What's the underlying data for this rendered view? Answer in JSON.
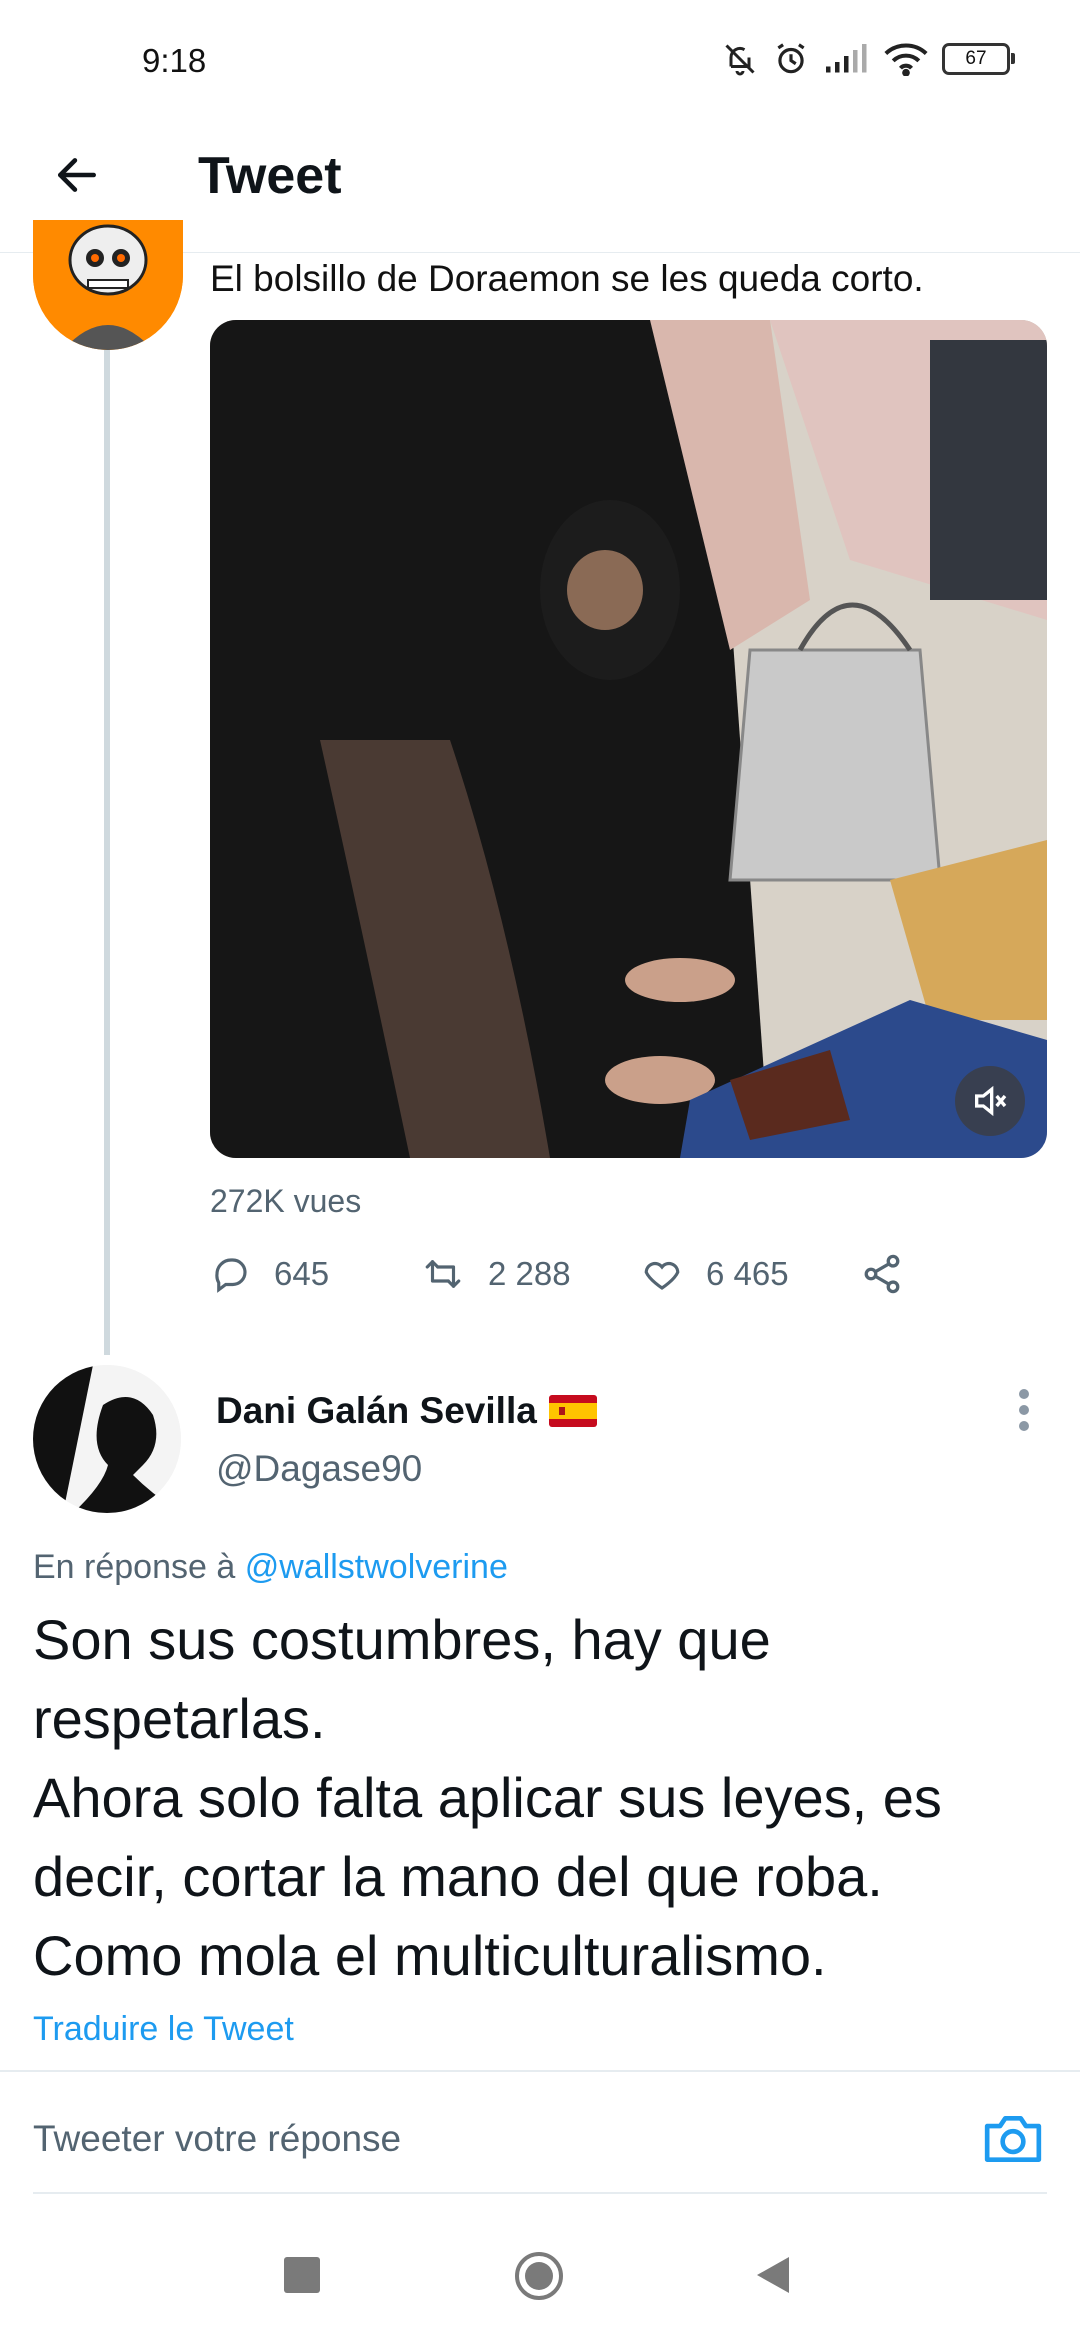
{
  "status_bar": {
    "time": "9:18",
    "battery": "67",
    "icons": [
      "bell-off-icon",
      "alarm-icon",
      "signal-icon",
      "wifi-icon",
      "battery-icon"
    ]
  },
  "header": {
    "title": "Tweet",
    "back_icon": "back-arrow-icon"
  },
  "original_tweet": {
    "text": "El bolsillo de Doraemon se les queda corto.",
    "views": "272K vues",
    "stats": {
      "replies": "645",
      "retweets": "2 288",
      "likes": "6 465"
    },
    "media_icon": "mute-icon"
  },
  "reply": {
    "author_name": "Dani Galán Sevilla",
    "handle": "@Dagase90",
    "in_reply_prefix": "En réponse à",
    "in_reply_handle": "@wallstwolverine",
    "lines": [
      "Son sus costumbres, hay que",
      "respetarlas.",
      "Ahora solo falta aplicar sus leyes, es",
      "decir, cortar la mano del que roba.",
      "Como mola el multiculturalismo."
    ],
    "translate_label": "Traduire le Tweet"
  },
  "composer": {
    "placeholder": "Tweeter votre réponse"
  },
  "colors": {
    "accent": "#1d9bf0",
    "secondary_text": "#536471",
    "divider": "#e6ecf0"
  }
}
